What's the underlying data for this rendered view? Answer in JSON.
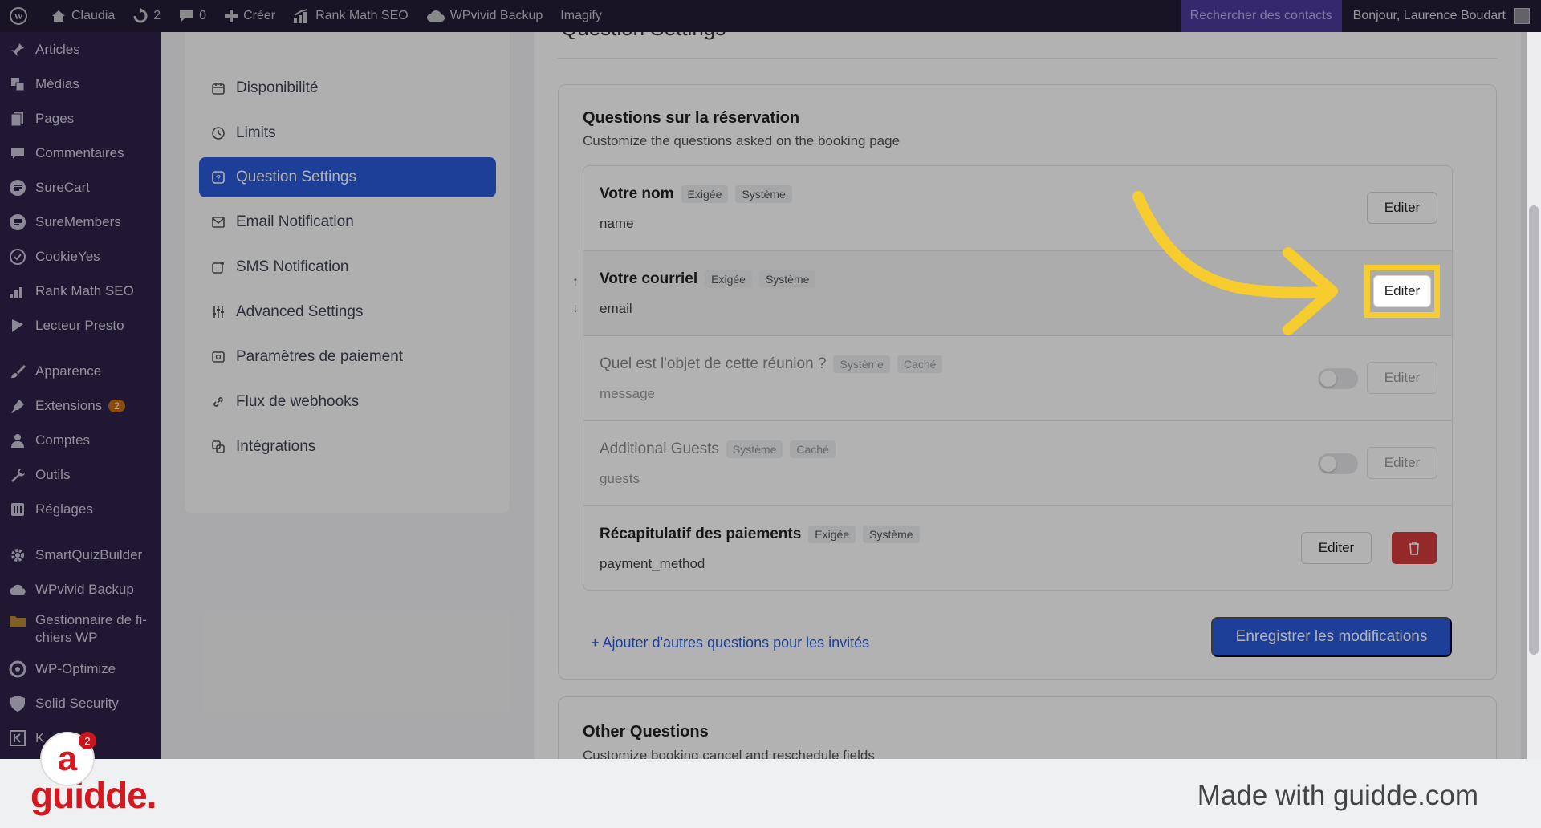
{
  "adminbar": {
    "site_name": "Claudia",
    "updates_count": "2",
    "comments_count": "0",
    "create_label": "Créer",
    "rankmath_label": "Rank Math SEO",
    "wpvivid_label": "WPvivid Backup",
    "imagify_label": "Imagify",
    "search_contacts_label": "Rechercher des contacts",
    "greeting": "Bonjour, Laurence Boudart"
  },
  "sidebar": {
    "items": [
      {
        "label": "Articles",
        "icon": "pin-icon"
      },
      {
        "label": "Médias",
        "icon": "media-icon"
      },
      {
        "label": "Pages",
        "icon": "pages-icon"
      },
      {
        "label": "Commentaires",
        "icon": "comment-icon"
      },
      {
        "label": "SureCart",
        "icon": "surecart-icon"
      },
      {
        "label": "SureMembers",
        "icon": "suremembers-icon"
      },
      {
        "label": "CookieYes",
        "icon": "cookie-icon"
      },
      {
        "label": "Rank Math SEO",
        "icon": "rankmath-icon"
      },
      {
        "label": "Lecteur Presto",
        "icon": "presto-icon"
      },
      {
        "label": "Apparence",
        "icon": "brush-icon"
      },
      {
        "label": "Extensions",
        "icon": "plugin-icon",
        "badge": "2"
      },
      {
        "label": "Comptes",
        "icon": "user-icon"
      },
      {
        "label": "Outils",
        "icon": "wrench-icon"
      },
      {
        "label": "Réglages",
        "icon": "settings-icon"
      },
      {
        "label": "SmartQuizBuilder",
        "icon": "gear-icon"
      },
      {
        "label": "WPvivid Backup",
        "icon": "cloud-icon"
      },
      {
        "label": "Gestionnaire de fi-\nchiers WP",
        "icon": "folder-icon"
      },
      {
        "label": "WP-Optimize",
        "icon": "optimize-icon"
      },
      {
        "label": "Solid Security",
        "icon": "shield-icon"
      },
      {
        "label": "K",
        "icon": "k-icon"
      }
    ]
  },
  "settings_nav": {
    "items": [
      {
        "label": "Disponibilité",
        "icon": "calendar-icon"
      },
      {
        "label": "Limits",
        "icon": "clock-icon"
      },
      {
        "label": "Question Settings",
        "icon": "question-icon",
        "active": true
      },
      {
        "label": "Email Notification",
        "icon": "mail-icon"
      },
      {
        "label": "SMS Notification",
        "icon": "sms-icon"
      },
      {
        "label": "Advanced Settings",
        "icon": "sliders-icon"
      },
      {
        "label": "Paramètres de paiement",
        "icon": "payment-icon"
      },
      {
        "label": "Flux de webhooks",
        "icon": "link-icon"
      },
      {
        "label": "Intégrations",
        "icon": "integrations-icon"
      }
    ]
  },
  "content": {
    "section_title": "Question Settings",
    "booking_questions": {
      "title": "Questions sur la réservation",
      "subtitle": "Customize the questions asked on the booking page",
      "rows": [
        {
          "name": "Votre nom",
          "tags": [
            "Exigée",
            "Système"
          ],
          "key": "name",
          "edit": "Editer"
        },
        {
          "name": "Votre courriel",
          "tags": [
            "Exigée",
            "Système"
          ],
          "key": "email",
          "edit": "Editer"
        },
        {
          "name": "Quel est l'objet de cette réunion ?",
          "tags": [
            "Système",
            "Caché"
          ],
          "key": "message",
          "edit": "Editer",
          "enabled": false
        },
        {
          "name": "Additional Guests",
          "tags": [
            "Système",
            "Caché"
          ],
          "key": "guests",
          "edit": "Editer",
          "enabled": false
        },
        {
          "name": "Récapitulatif des paiements",
          "tags": [
            "Exigée",
            "Système"
          ],
          "key": "payment_method",
          "edit": "Editer"
        }
      ],
      "add_link": "+ Ajouter d'autres questions pour les invités",
      "save_button": "Enregistrer les modifications"
    },
    "other_questions": {
      "title": "Other Questions",
      "subtitle": "Customize booking cancel and reschedule fields"
    }
  },
  "footer": {
    "logo": "guidde.",
    "made_with": "Made with guidde.com",
    "badge_count": "2"
  },
  "colors": {
    "accent": "#2c5bd8",
    "highlight": "#f7cc2e",
    "danger": "#d43c3c",
    "brand": "#d5171f"
  }
}
